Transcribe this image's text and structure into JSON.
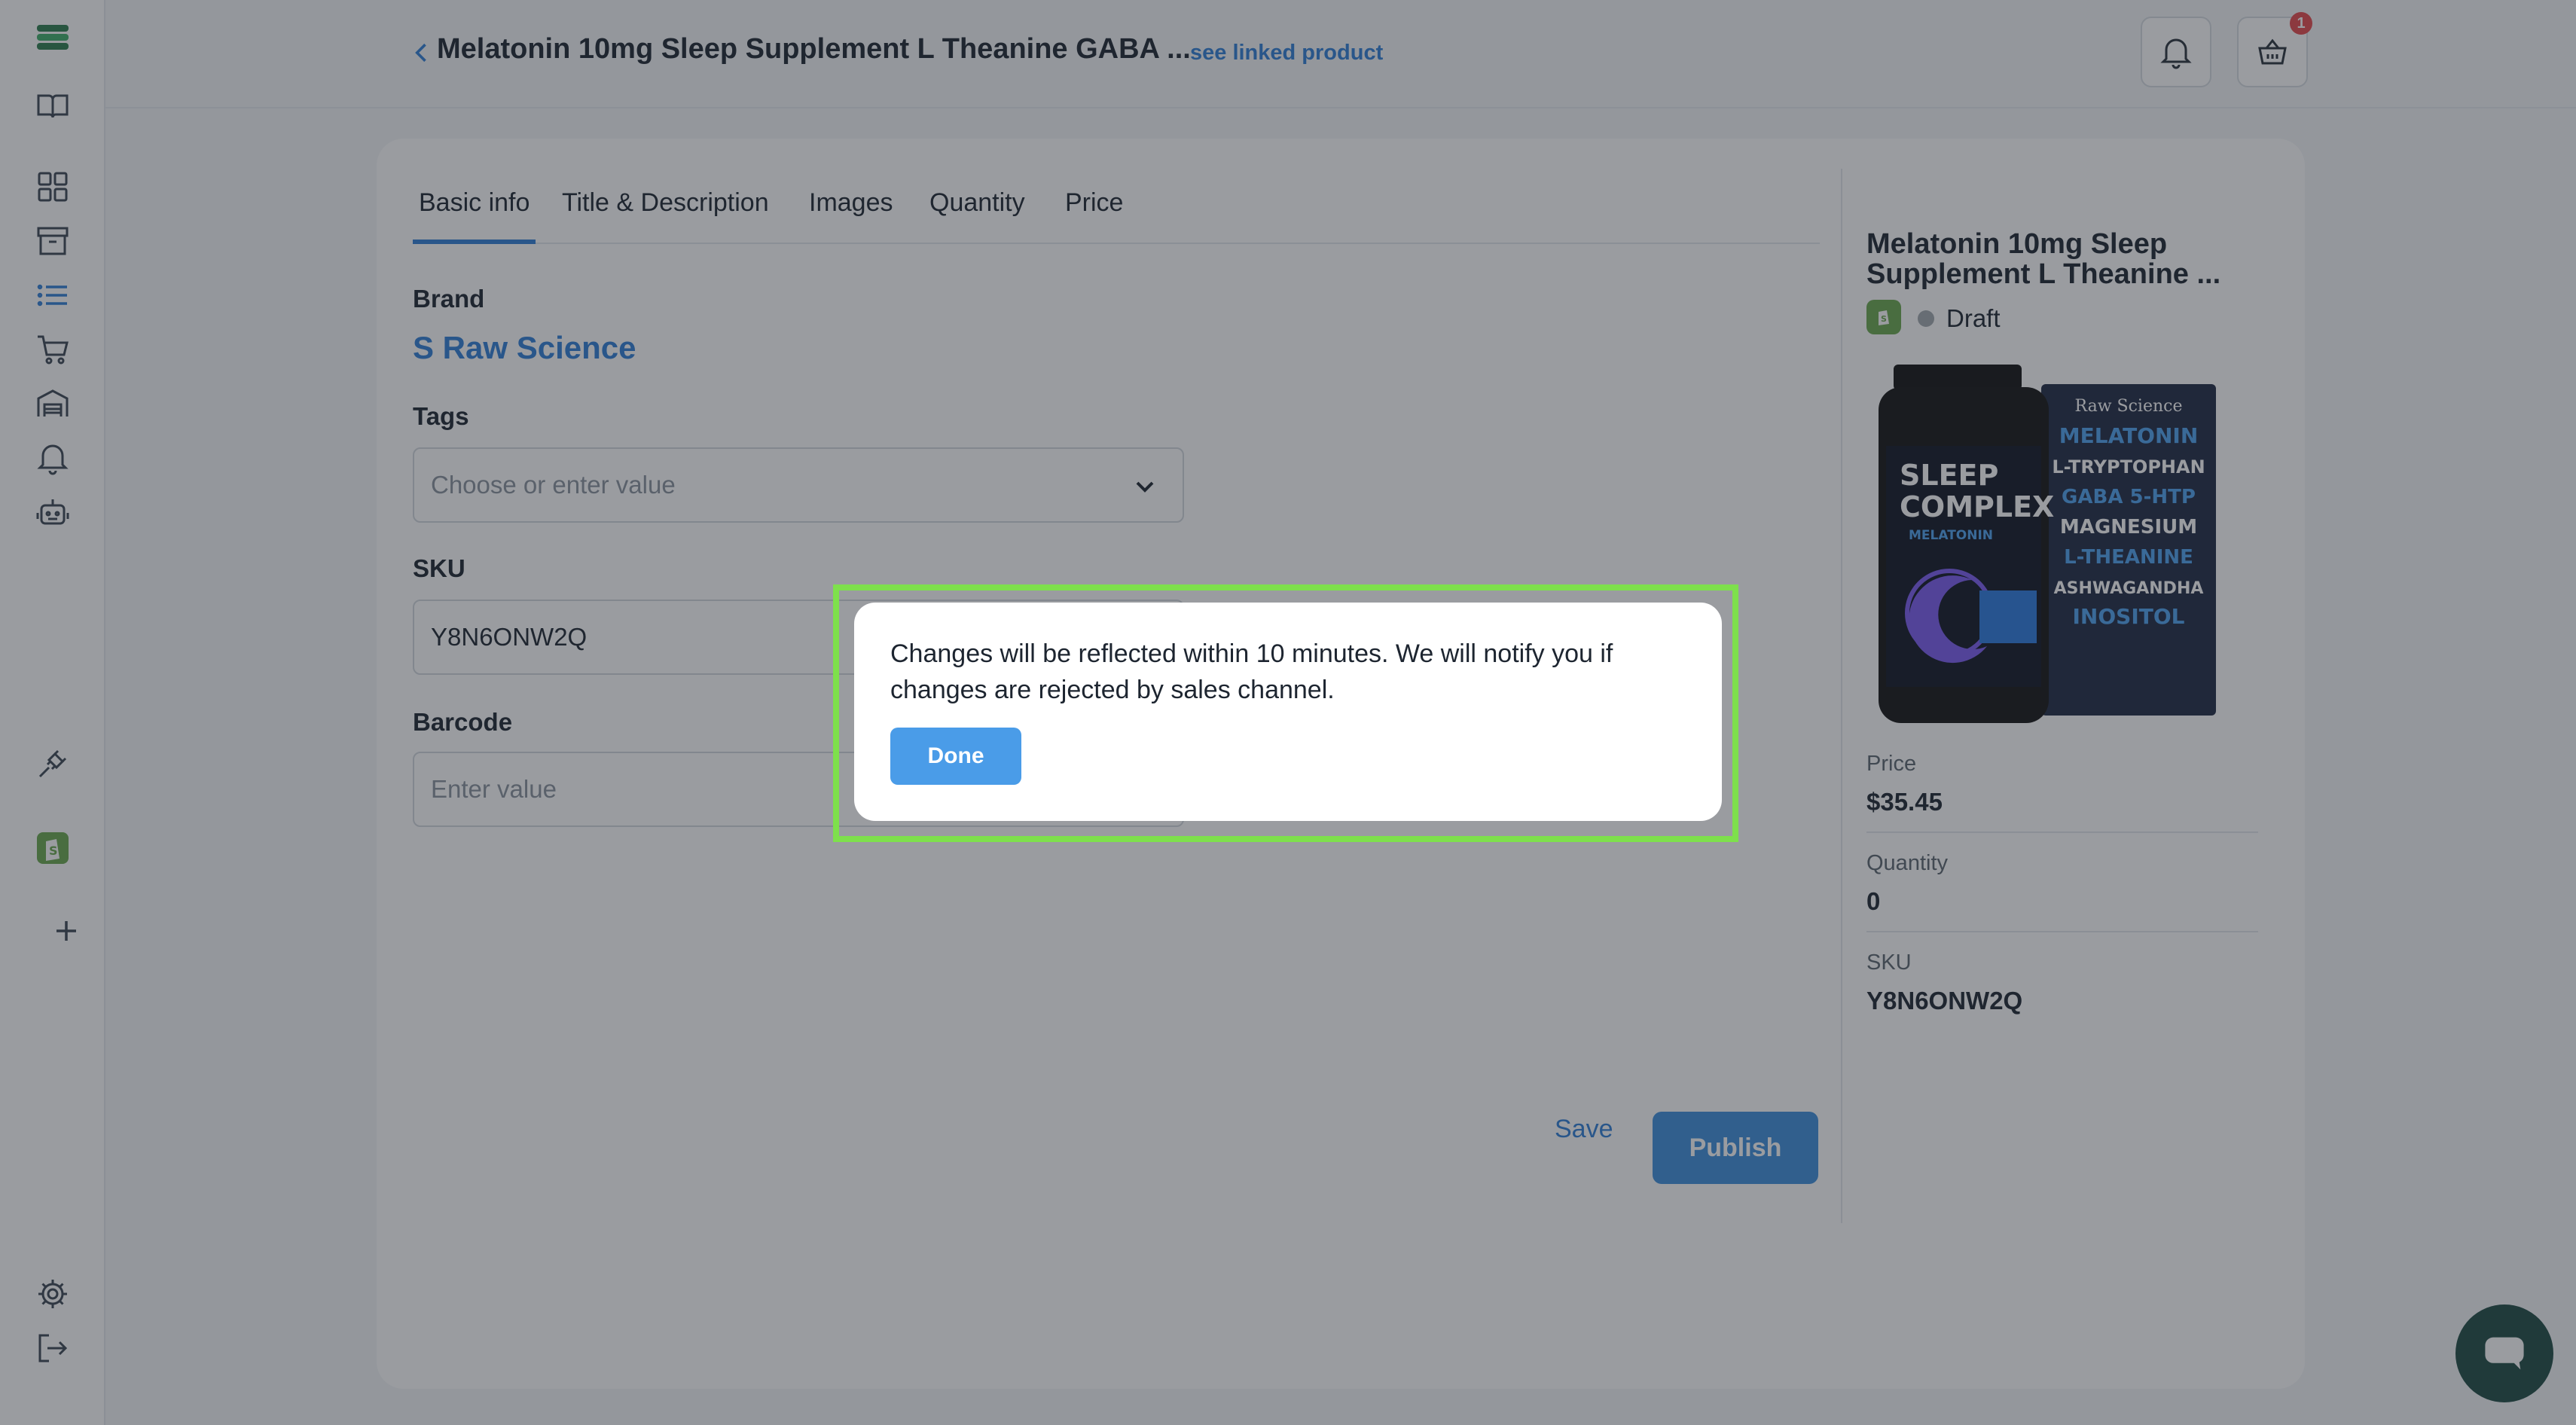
{
  "header": {
    "title": "Melatonin 10mg Sleep Supplement L Theanine GABA ...",
    "linked_label": "see linked product",
    "cart_count": "1"
  },
  "sidebar": {
    "icons": [
      "logo-icon",
      "book-icon",
      "dashboard-icon",
      "archive-icon",
      "list-icon",
      "cart-icon",
      "warehouse-icon",
      "bell-icon",
      "bot-icon",
      "plug-icon",
      "shopify-icon",
      "plus-icon",
      "gear-icon",
      "logout-icon"
    ]
  },
  "tabs": [
    {
      "label": "Basic info"
    },
    {
      "label": "Title & Description"
    },
    {
      "label": "Images"
    },
    {
      "label": "Quantity"
    },
    {
      "label": "Price"
    }
  ],
  "form": {
    "brand_label": "Brand",
    "brand_value": "S Raw Science",
    "tags_label": "Tags",
    "tags_placeholder": "Choose or enter value",
    "sku_label": "SKU",
    "sku_value": "Y8N6ONW2Q",
    "barcode_label": "Barcode",
    "barcode_placeholder": "Enter value",
    "save_label": "Save",
    "publish_label": "Publish"
  },
  "summary": {
    "title": "Melatonin 10mg Sleep Supplement L Theanine ...",
    "status": "Draft",
    "price_label": "Price",
    "price_value": "$35.45",
    "quantity_label": "Quantity",
    "quantity_value": "0",
    "sku_label": "SKU",
    "sku_value": "Y8N6ONW2Q",
    "image": {
      "bottle_lines": [
        "SLEEP",
        "COMPLEX"
      ],
      "bottle_sub": "MELATONIN",
      "box_brand": "Raw Science",
      "box_lines": [
        "MELATONIN",
        "L-TRYPTOPHAN",
        "GABA 5-HTP",
        "MAGNESIUM",
        "L-THEANINE",
        "ASHWAGANDHA",
        "INOSITOL"
      ]
    }
  },
  "modal": {
    "message": "Changes will be reflected within 10 minutes. We will notify you if changes are rejected by sales channel.",
    "done_label": "Done"
  },
  "colors": {
    "accent": "#2f7fd6",
    "highlight": "#7ee04c",
    "chat": "#1e4a44"
  }
}
